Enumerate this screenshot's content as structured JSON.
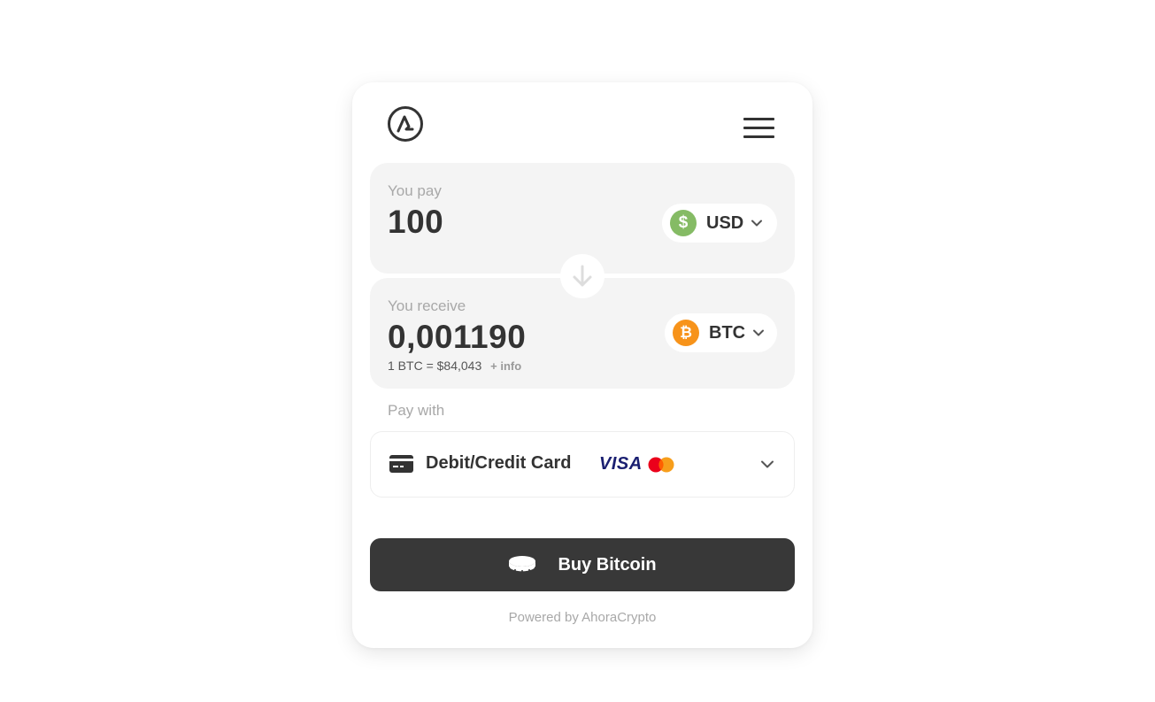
{
  "header": {
    "logo_icon": "ahoracrypto-logo-icon",
    "menu_icon": "hamburger-menu-icon"
  },
  "pay": {
    "label": "You pay",
    "amount": "100",
    "currency_code": "USD",
    "currency_symbol": "$",
    "currency_color": "#85bb65"
  },
  "swap_icon": "arrow-down-icon",
  "receive": {
    "label": "You receive",
    "amount": "0,001190",
    "currency_code": "BTC",
    "currency_symbol": "₿",
    "currency_color": "#f7931a",
    "rate": "1 BTC = $84,043",
    "info_link": "+ info"
  },
  "payment": {
    "label": "Pay with",
    "method": "Debit/Credit Card",
    "card_icon": "credit-card-icon",
    "visa_text": "VISA",
    "mastercard_icon": "mastercard-logo-icon",
    "visa_color": "#1a1f71"
  },
  "buy_button": {
    "label": "Buy Bitcoin",
    "icon": "coins-icon",
    "background": "#383838"
  },
  "footer": {
    "powered_by": "Powered by AhoraCrypto"
  }
}
